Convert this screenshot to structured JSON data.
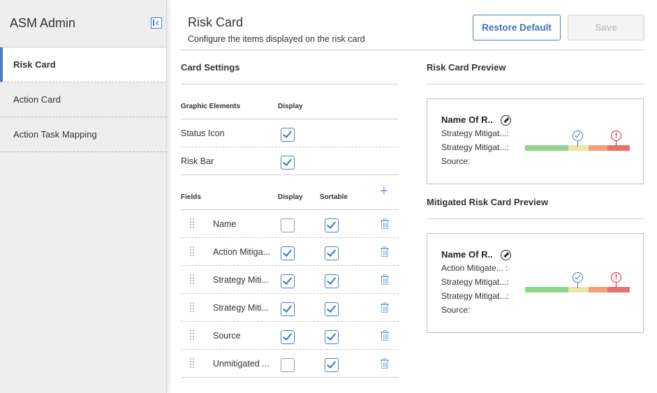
{
  "sidebar": {
    "title": "ASM Admin",
    "items": [
      {
        "label": "Risk Card",
        "active": true
      },
      {
        "label": "Action Card",
        "active": false
      },
      {
        "label": "Action Task Mapping",
        "active": false
      }
    ]
  },
  "header": {
    "title": "Risk Card",
    "subtitle": "Configure the items displayed on the risk card",
    "restore_label": "Restore Default",
    "save_label": "Save"
  },
  "card_settings": {
    "title": "Card Settings",
    "graphic_header": "Graphic Elements",
    "display_header": "Display",
    "graphics": [
      {
        "label": "Status Icon",
        "display": true
      },
      {
        "label": "Risk Bar",
        "display": true
      }
    ],
    "fields_header": "Fields",
    "fields_display_header": "Display",
    "sortable_header": "Sortable",
    "fields": [
      {
        "label": "Name",
        "display": false,
        "sortable": true
      },
      {
        "label": "Action Mitiga...",
        "display": true,
        "sortable": true
      },
      {
        "label": "Strategy Miti...",
        "display": true,
        "sortable": true
      },
      {
        "label": "Strategy Miti...",
        "display": true,
        "sortable": true
      },
      {
        "label": "Source",
        "display": true,
        "sortable": true
      },
      {
        "label": "Unmitigated ...",
        "display": false,
        "sortable": true
      }
    ]
  },
  "risk_preview": {
    "title": "Risk Card Preview",
    "name": "Name Of R..",
    "lines": [
      "Strategy Mitigat...:",
      "Strategy Mitigat...:",
      "Source:"
    ]
  },
  "mitigated_preview": {
    "title": "Mitigated Risk Card Preview",
    "name": "Name Of R..",
    "lines": [
      "Action Mitigate... :",
      "Strategy Mitigat...:",
      "Strategy Mitigat...:",
      "Source:"
    ]
  },
  "colors": {
    "accent": "#4a7fc1",
    "bar_green": "#92d58a",
    "bar_yellow": "#ece5a5",
    "bar_orange": "#f2a07a",
    "bar_red": "#ec6f6f",
    "risk_marker": "#dd2222"
  }
}
